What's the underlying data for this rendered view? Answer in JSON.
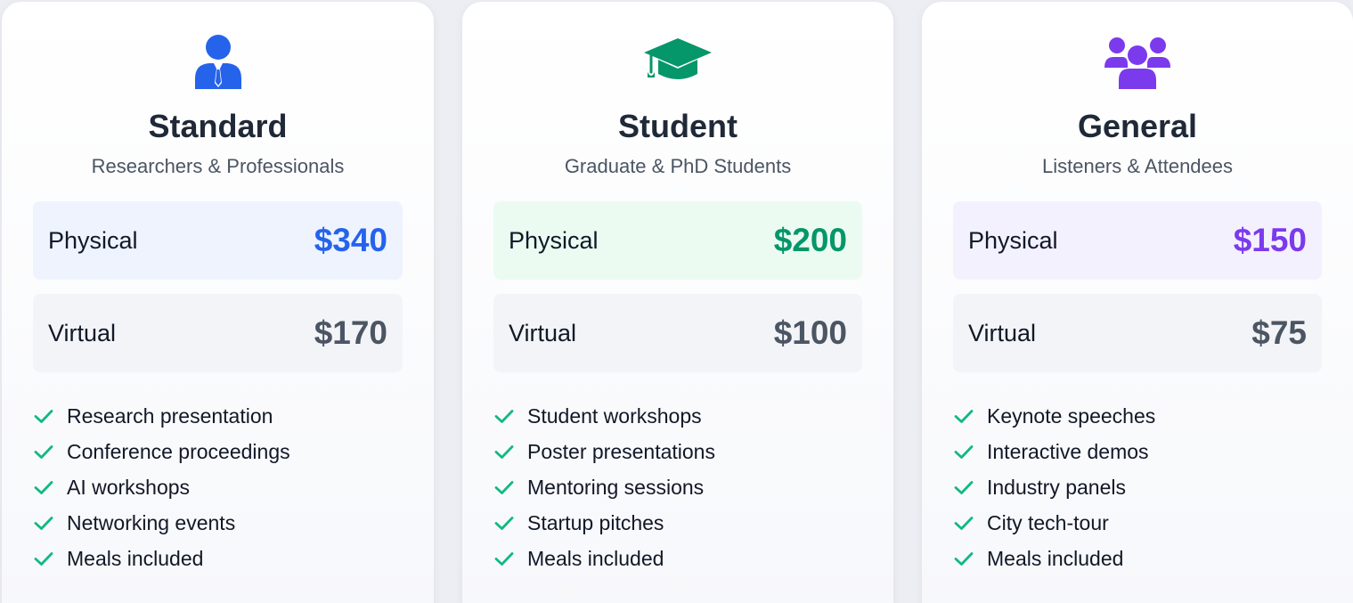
{
  "colors": {
    "standard_accent": "#2563eb",
    "standard_tint": "#eef3fe",
    "student_accent": "#059669",
    "student_tint": "#ebfbf2",
    "general_accent": "#7c3aed",
    "general_tint": "#f4f1fe",
    "check": "#10b981"
  },
  "plans": [
    {
      "icon": "user-tie-icon",
      "title": "Standard",
      "subtitle": "Researchers & Professionals",
      "physical_label": "Physical",
      "physical_price": "$340",
      "virtual_label": "Virtual",
      "virtual_price": "$170",
      "features": [
        "Research presentation",
        "Conference proceedings",
        "AI workshops",
        "Networking events",
        "Meals included"
      ]
    },
    {
      "icon": "graduation-cap-icon",
      "title": "Student",
      "subtitle": "Graduate & PhD Students",
      "physical_label": "Physical",
      "physical_price": "$200",
      "virtual_label": "Virtual",
      "virtual_price": "$100",
      "features": [
        "Student workshops",
        "Poster presentations",
        "Mentoring sessions",
        "Startup pitches",
        "Meals included"
      ]
    },
    {
      "icon": "users-icon",
      "title": "General",
      "subtitle": "Listeners & Attendees",
      "physical_label": "Physical",
      "physical_price": "$150",
      "virtual_label": "Virtual",
      "virtual_price": "$75",
      "features": [
        "Keynote speeches",
        "Interactive demos",
        "Industry panels",
        "City tech-tour",
        "Meals included"
      ]
    }
  ]
}
